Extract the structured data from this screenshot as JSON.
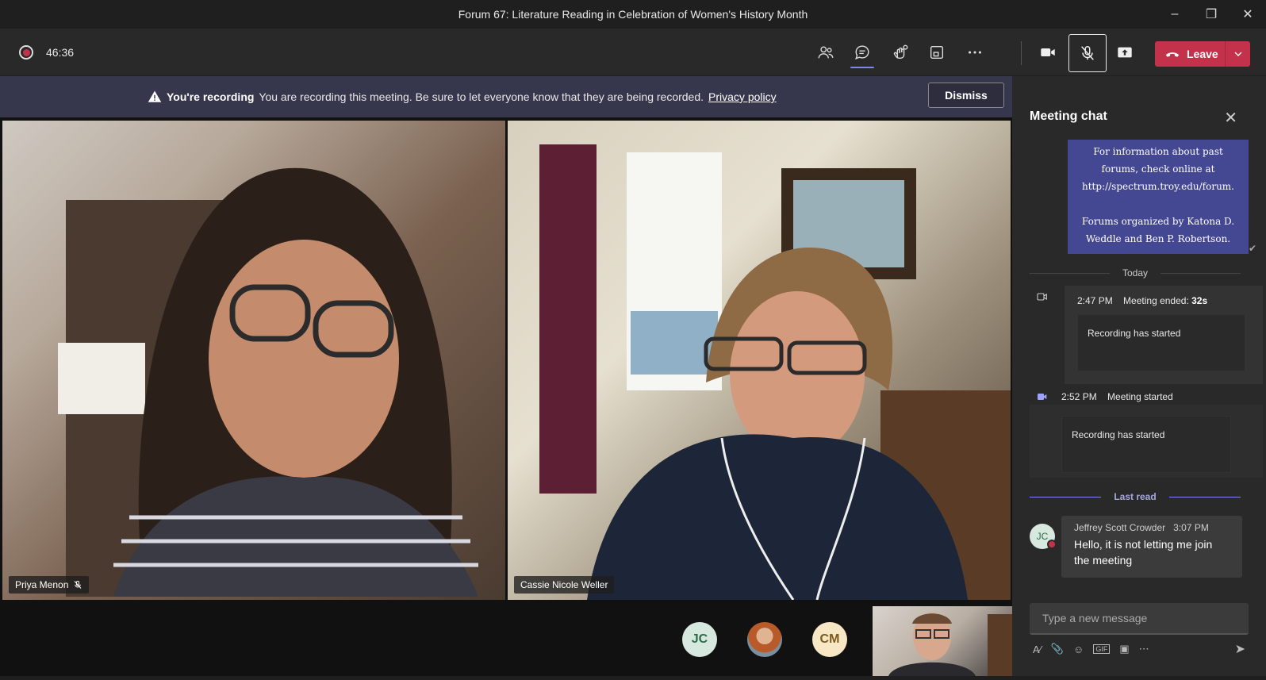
{
  "window": {
    "title": "Forum 67: Literature Reading in Celebration of Women's History Month"
  },
  "toolbar": {
    "timer": "46:36",
    "leave_label": "Leave",
    "icons": [
      "people-icon",
      "chat-icon",
      "reactions-icon",
      "share-tray-icon",
      "more-icon",
      "camera-icon",
      "mic-off-icon",
      "share-icon"
    ]
  },
  "banner": {
    "title": "You're recording",
    "message": "You are recording this meeting. Be sure to let everyone know that they are being recorded.",
    "link": "Privacy policy",
    "dismiss_label": "Dismiss"
  },
  "participants": {
    "tile1_name": "Priya Menon",
    "tile2_name": "Cassie Nicole Weller",
    "avatar1_initials": "JC",
    "avatar3_initials": "CM"
  },
  "chat": {
    "title": "Meeting chat",
    "notice_line1": "For information about past",
    "notice_line2": "forums, check online at",
    "notice_line3": "http://spectrum.troy.edu/forum.",
    "notice_line4": "Forums organized by Katona D.",
    "notice_line5": "Weddle and Ben P. Robertson.",
    "today_label": "Today",
    "event1_time": "2:47 PM",
    "event1_text": "Meeting ended:",
    "event1_duration": "32s",
    "event1_card": "Recording has started",
    "event2_time": "2:52 PM",
    "event2_text": "Meeting started",
    "event2_card": "Recording has started",
    "last_read_label": "Last read",
    "message": {
      "initials": "JC",
      "sender": "Jeffrey Scott Crowder",
      "time": "3:07 PM",
      "text": "Hello, it is not letting me join the meeting"
    },
    "compose_placeholder": "Type a new message"
  },
  "colors": {
    "accent": "#7f85f5",
    "leave": "#c4314b",
    "banner": "#36374d",
    "notice": "#444791"
  }
}
